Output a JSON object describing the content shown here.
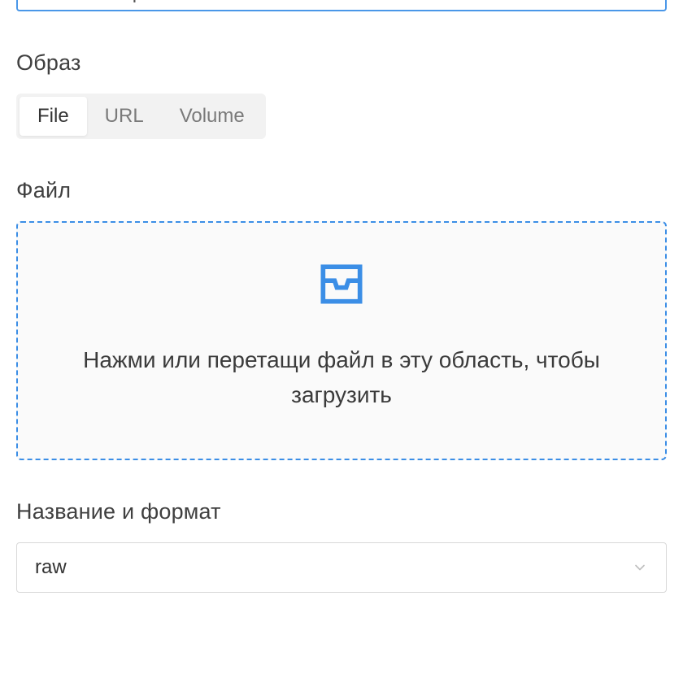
{
  "top_input": {
    "value": "timeweb-expert"
  },
  "image_section": {
    "label": "Образ",
    "tabs": [
      {
        "label": "File",
        "active": true
      },
      {
        "label": "URL",
        "active": false
      },
      {
        "label": "Volume",
        "active": false
      }
    ]
  },
  "file_section": {
    "label": "Файл",
    "dropzone_text": "Нажми или перетащи файл в эту область, чтобы загрузить"
  },
  "name_format_section": {
    "label": "Название и формат",
    "selected": "raw"
  }
}
